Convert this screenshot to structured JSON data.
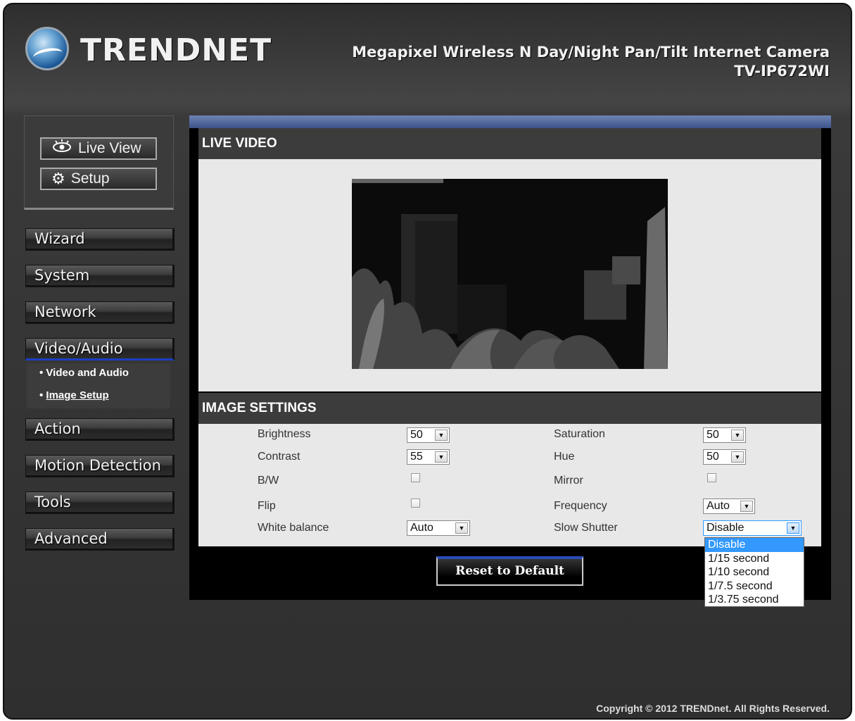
{
  "header": {
    "logo_text": "TRENDNET",
    "product_name": "Megapixel Wireless N Day/Night Pan/Tilt Internet Camera",
    "model": "TV-IP672WI"
  },
  "top_buttons": {
    "live_view": "Live View",
    "setup": "Setup"
  },
  "nav": {
    "items": [
      "Wizard",
      "System",
      "Network",
      "Video/Audio",
      "Action",
      "Motion Detection",
      "Tools",
      "Advanced"
    ],
    "active": "Video/Audio",
    "sub_items": [
      "Video and Audio",
      "Image Setup"
    ],
    "current_sub": "Image Setup"
  },
  "live_video": {
    "title": "LIVE VIDEO"
  },
  "image_settings": {
    "title": "IMAGE SETTINGS",
    "brightness": {
      "label": "Brightness",
      "value": "50"
    },
    "contrast": {
      "label": "Contrast",
      "value": "55"
    },
    "bw": {
      "label": "B/W",
      "checked": false
    },
    "flip": {
      "label": "Flip",
      "checked": false
    },
    "white_balance": {
      "label": "White balance",
      "value": "Auto"
    },
    "saturation": {
      "label": "Saturation",
      "value": "50"
    },
    "hue": {
      "label": "Hue",
      "value": "50"
    },
    "mirror": {
      "label": "Mirror",
      "checked": false
    },
    "frequency": {
      "label": "Frequency",
      "value": "Auto"
    },
    "slow_shutter": {
      "label": "Slow Shutter",
      "value": "Disable",
      "options": [
        "Disable",
        "1/15 second",
        "1/10 second",
        "1/7.5 second",
        "1/3.75 second"
      ],
      "highlighted": "Disable"
    }
  },
  "reset_label": "Reset to Default",
  "footer": "Copyright © 2012 TRENDnet. All Rights Reserved.",
  "colors": {
    "accent_blue": "#3c5289",
    "highlight": "#3399ff",
    "panel_bg": "#e8e8e8"
  }
}
